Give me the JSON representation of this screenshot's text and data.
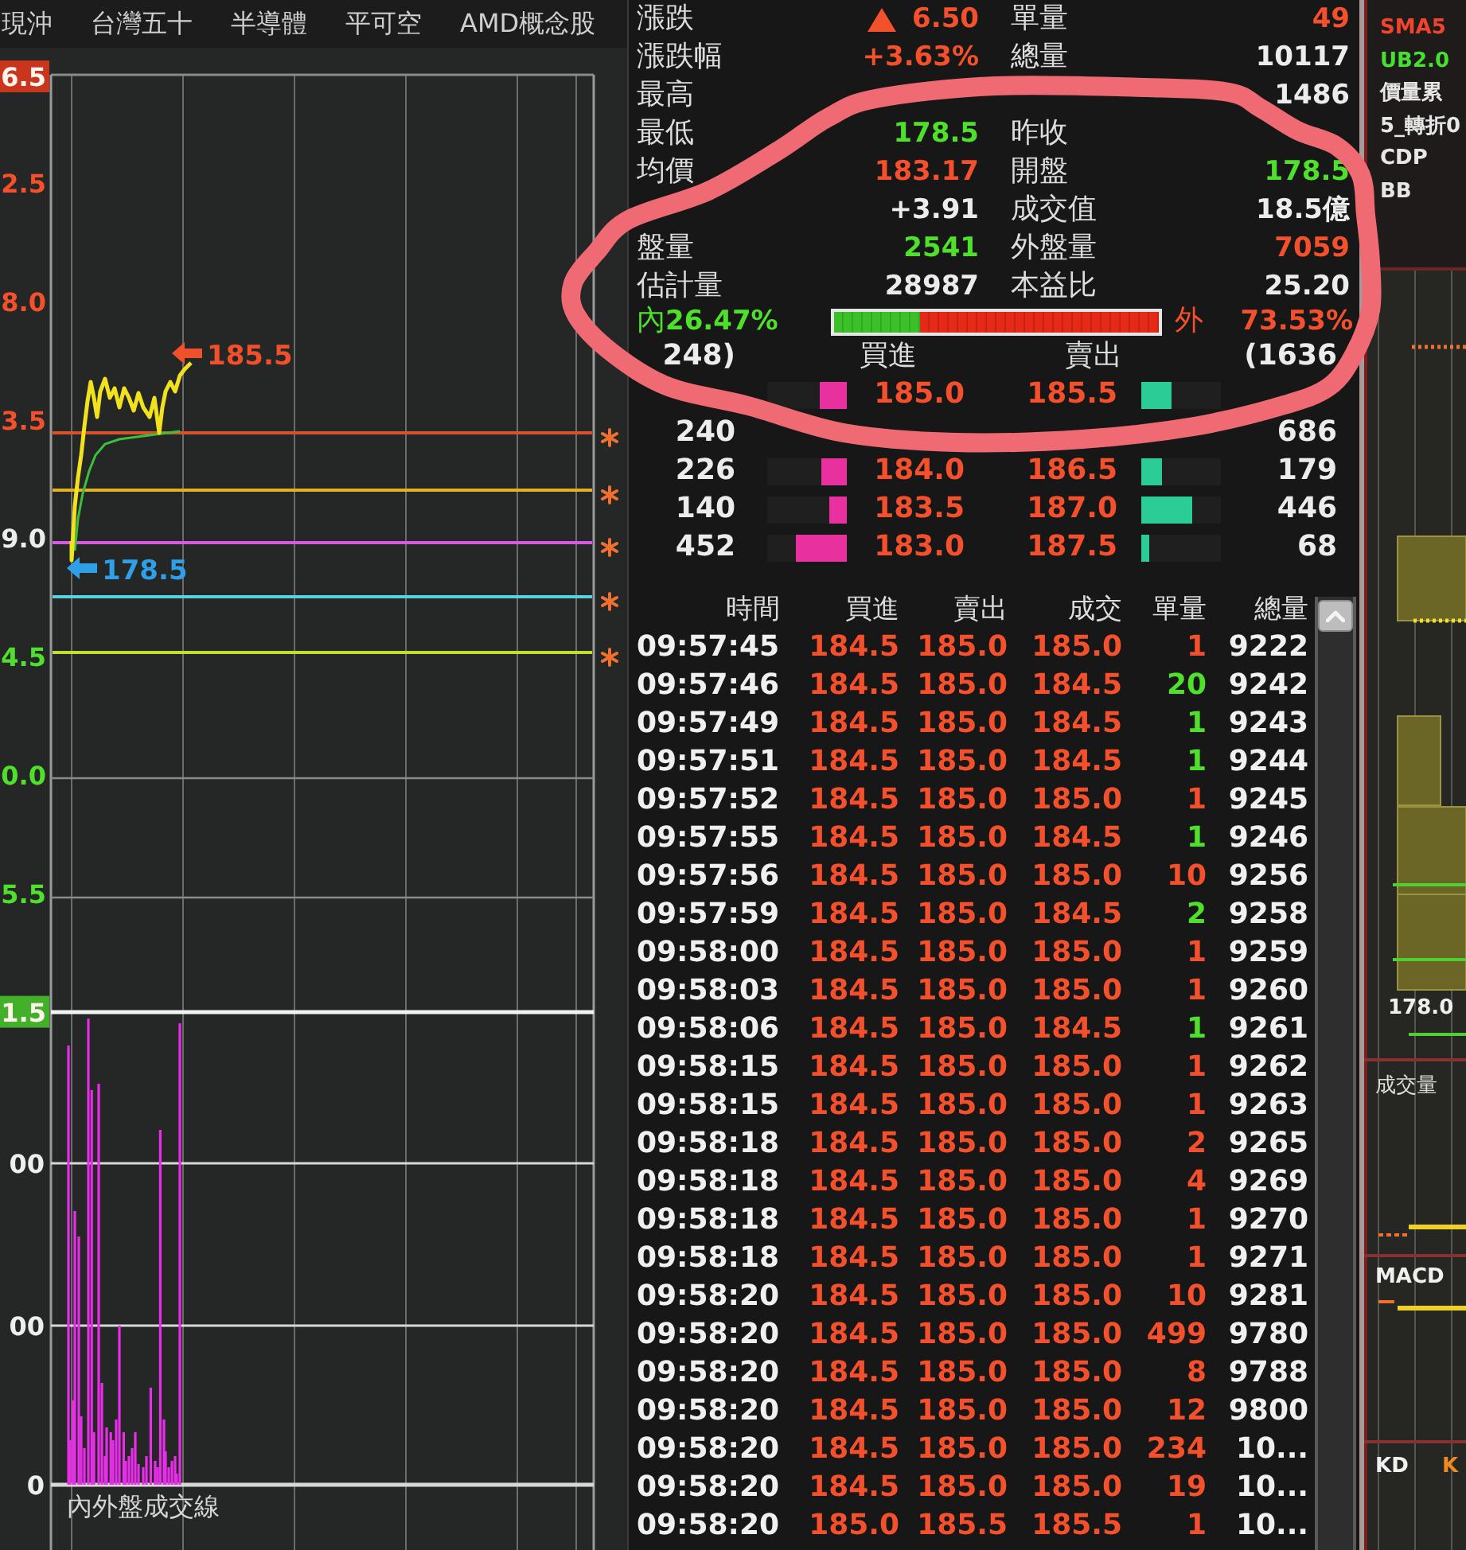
{
  "tabs": [
    {
      "label": "現沖",
      "selected": false
    },
    {
      "label": "台灣五十",
      "selected": false
    },
    {
      "label": "半導體",
      "selected": false
    },
    {
      "label": "平可空",
      "selected": false
    },
    {
      "label": "AMD概念股",
      "selected": false
    }
  ],
  "price_chart": {
    "axis_labels": [
      {
        "text": "6.5",
        "color": "#c9361e",
        "boxed": true
      },
      {
        "text": "2.5",
        "color": "#f5502c",
        "boxed": false
      },
      {
        "text": "8.0",
        "color": "#f5502c",
        "boxed": false
      },
      {
        "text": "3.5",
        "color": "#f5502c",
        "boxed": false
      },
      {
        "text": "9.0",
        "color": "#ececec",
        "boxed": false
      },
      {
        "text": "4.5",
        "color": "#4fe02c",
        "boxed": false
      },
      {
        "text": "0.0",
        "color": "#4fe02c",
        "boxed": false
      },
      {
        "text": "5.5",
        "color": "#4fe02c",
        "boxed": false
      },
      {
        "text": "1.5",
        "color": "#43b02a",
        "boxed": true
      }
    ],
    "high_marker": "185.5",
    "low_marker": "178.5",
    "volume_axis_labels": [
      "00",
      "00",
      "0"
    ],
    "caption": "內外盤成交線"
  },
  "quote": {
    "rows": [
      {
        "left": {
          "label": "漲跌",
          "up_arrow": true,
          "value": "6.50",
          "color": "#f5502c"
        },
        "right": {
          "label": "單量",
          "value": "49",
          "color": "#f5502c"
        }
      },
      {
        "left": {
          "label": "漲跌幅",
          "value": "+3.63%",
          "color": "#f5502c"
        },
        "right": {
          "label": "總量",
          "value": "10117",
          "color": "#ececec"
        }
      },
      {
        "left": {
          "label": "最高"
        },
        "right": {
          "value": "1486",
          "color": "#ececec"
        }
      },
      {
        "left": {
          "label": "最低",
          "value": "178.5",
          "color": "#4fe02c"
        },
        "right": {
          "label": "昨收"
        }
      },
      {
        "left": {
          "label": "均價",
          "value": "183.17",
          "color": "#f5502c"
        },
        "right": {
          "label": "開盤",
          "value": "178.5",
          "color": "#4fe02c"
        }
      },
      {
        "left": {
          "value": "+3.91",
          "color": "#ececec"
        },
        "right": {
          "label": "成交值",
          "value": "18.5億",
          "color": "#ececec"
        }
      },
      {
        "left": {
          "label": "盤量",
          "value": "2541",
          "color": "#4fe02c"
        },
        "right": {
          "label": "外盤量",
          "value": "7059",
          "color": "#f5502c"
        }
      },
      {
        "left": {
          "label": "估計量",
          "value": "28987",
          "color": "#ececec"
        },
        "right": {
          "label": "本益比",
          "value": "25.20",
          "color": "#ececec"
        }
      }
    ]
  },
  "ratio": {
    "inner_label": "內",
    "inner_percent": "26.47%",
    "level": 0.2647,
    "outer_label": "外",
    "outer_percent": "73.53%"
  },
  "order_book": {
    "bid_total": "248)",
    "bid_header": "買進",
    "ask_header": "賣出",
    "ask_total": "(1636",
    "rows": [
      {
        "bid_bar": {
          "level": 0.34
        },
        "bid_price": "185.0",
        "ask_price": "185.5",
        "ask_bar": {
          "level": 0.38
        }
      },
      {
        "bid_qty": "240",
        "ask_qty": "686"
      },
      {
        "bid_qty": "226",
        "bid_bar": {
          "level": 0.32
        },
        "bid_price": "184.0",
        "ask_price": "186.5",
        "ask_bar": {
          "level": 0.26
        },
        "ask_qty": "179"
      },
      {
        "bid_qty": "140",
        "bid_bar": {
          "level": 0.22
        },
        "bid_price": "183.5",
        "ask_price": "187.0",
        "ask_bar": {
          "level": 0.64
        },
        "ask_qty": "446"
      },
      {
        "bid_qty": "452",
        "bid_bar": {
          "level": 0.64
        },
        "bid_price": "183.0",
        "ask_price": "187.5",
        "ask_bar": {
          "level": 0.1
        },
        "ask_qty": "68"
      }
    ]
  },
  "time_sales": {
    "columns": [
      "時間",
      "買進",
      "賣出",
      "成交",
      "單量",
      "總量"
    ],
    "rows": [
      {
        "time": "09:57:45",
        "bid": "184.5",
        "ask": "185.0",
        "price": "185.0",
        "qty": "1",
        "color": "#f5502c",
        "total": "9222"
      },
      {
        "time": "09:57:46",
        "bid": "184.5",
        "ask": "185.0",
        "price": "184.5",
        "qty": "20",
        "color": "#4fe02c",
        "total": "9242"
      },
      {
        "time": "09:57:49",
        "bid": "184.5",
        "ask": "185.0",
        "price": "184.5",
        "qty": "1",
        "color": "#4fe02c",
        "total": "9243"
      },
      {
        "time": "09:57:51",
        "bid": "184.5",
        "ask": "185.0",
        "price": "184.5",
        "qty": "1",
        "color": "#4fe02c",
        "total": "9244"
      },
      {
        "time": "09:57:52",
        "bid": "184.5",
        "ask": "185.0",
        "price": "185.0",
        "qty": "1",
        "color": "#f5502c",
        "total": "9245"
      },
      {
        "time": "09:57:55",
        "bid": "184.5",
        "ask": "185.0",
        "price": "184.5",
        "qty": "1",
        "color": "#4fe02c",
        "total": "9246"
      },
      {
        "time": "09:57:56",
        "bid": "184.5",
        "ask": "185.0",
        "price": "185.0",
        "qty": "10",
        "color": "#f5502c",
        "total": "9256"
      },
      {
        "time": "09:57:59",
        "bid": "184.5",
        "ask": "185.0",
        "price": "184.5",
        "qty": "2",
        "color": "#4fe02c",
        "total": "9258"
      },
      {
        "time": "09:58:00",
        "bid": "184.5",
        "ask": "185.0",
        "price": "185.0",
        "qty": "1",
        "color": "#f5502c",
        "total": "9259"
      },
      {
        "time": "09:58:03",
        "bid": "184.5",
        "ask": "185.0",
        "price": "185.0",
        "qty": "1",
        "color": "#f5502c",
        "total": "9260"
      },
      {
        "time": "09:58:06",
        "bid": "184.5",
        "ask": "185.0",
        "price": "184.5",
        "qty": "1",
        "color": "#4fe02c",
        "total": "9261"
      },
      {
        "time": "09:58:15",
        "bid": "184.5",
        "ask": "185.0",
        "price": "185.0",
        "qty": "1",
        "color": "#f5502c",
        "total": "9262"
      },
      {
        "time": "09:58:15",
        "bid": "184.5",
        "ask": "185.0",
        "price": "185.0",
        "qty": "1",
        "color": "#f5502c",
        "total": "9263"
      },
      {
        "time": "09:58:18",
        "bid": "184.5",
        "ask": "185.0",
        "price": "185.0",
        "qty": "2",
        "color": "#f5502c",
        "total": "9265"
      },
      {
        "time": "09:58:18",
        "bid": "184.5",
        "ask": "185.0",
        "price": "185.0",
        "qty": "4",
        "color": "#f5502c",
        "total": "9269"
      },
      {
        "time": "09:58:18",
        "bid": "184.5",
        "ask": "185.0",
        "price": "185.0",
        "qty": "1",
        "color": "#f5502c",
        "total": "9270"
      },
      {
        "time": "09:58:18",
        "bid": "184.5",
        "ask": "185.0",
        "price": "185.0",
        "qty": "1",
        "color": "#f5502c",
        "total": "9271"
      },
      {
        "time": "09:58:20",
        "bid": "184.5",
        "ask": "185.0",
        "price": "185.0",
        "qty": "10",
        "color": "#f5502c",
        "total": "9281"
      },
      {
        "time": "09:58:20",
        "bid": "184.5",
        "ask": "185.0",
        "price": "185.0",
        "qty": "499",
        "color": "#f5502c",
        "total": "9780"
      },
      {
        "time": "09:58:20",
        "bid": "184.5",
        "ask": "185.0",
        "price": "185.0",
        "qty": "8",
        "color": "#f5502c",
        "total": "9788"
      },
      {
        "time": "09:58:20",
        "bid": "184.5",
        "ask": "185.0",
        "price": "185.0",
        "qty": "12",
        "color": "#f5502c",
        "total": "9800"
      },
      {
        "time": "09:58:20",
        "bid": "184.5",
        "ask": "185.0",
        "price": "185.0",
        "qty": "234",
        "color": "#f5502c",
        "total": "10..."
      },
      {
        "time": "09:58:20",
        "bid": "184.5",
        "ask": "185.0",
        "price": "185.0",
        "qty": "19",
        "color": "#f5502c",
        "total": "10..."
      },
      {
        "time": "09:58:20",
        "bid": "185.0",
        "ask": "185.5",
        "price": "185.5",
        "qty": "1",
        "color": "#f5502c",
        "total": "10..."
      }
    ]
  },
  "right_panel": {
    "legend": [
      {
        "text": "SMA5",
        "color": "#f0442c"
      },
      {
        "text": "UB2.0",
        "color": "#48e030"
      },
      {
        "text": "價量累",
        "color": "#e6e6e6"
      },
      {
        "text": "5_轉折0",
        "color": "#e6e6e6"
      },
      {
        "text": "CDP",
        "color": "#e6e6e6"
      },
      {
        "text": "BB",
        "color": "#e6e6e6"
      }
    ],
    "price_label": "178.0",
    "panels": [
      {
        "title": "成交量"
      },
      {
        "title": "MACD"
      },
      {
        "title": "KD",
        "tag": "K"
      }
    ]
  }
}
